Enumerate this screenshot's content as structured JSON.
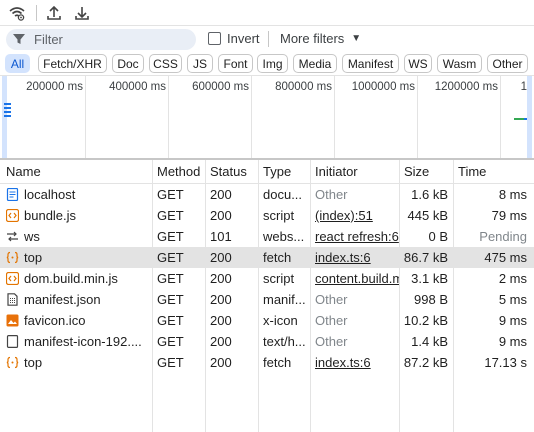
{
  "toolbar": {
    "icons": [
      "network-conditions-icon",
      "import-har-icon",
      "export-har-icon"
    ]
  },
  "filter": {
    "placeholder": "Filter",
    "invert_label": "Invert",
    "invert_checked": false,
    "more_filters_label": "More filters"
  },
  "chips": [
    {
      "label": "All",
      "active": true
    },
    {
      "label": "Fetch/XHR",
      "active": false
    },
    {
      "label": "Doc",
      "active": false
    },
    {
      "label": "CSS",
      "active": false
    },
    {
      "label": "JS",
      "active": false
    },
    {
      "label": "Font",
      "active": false
    },
    {
      "label": "Img",
      "active": false
    },
    {
      "label": "Media",
      "active": false
    },
    {
      "label": "Manifest",
      "active": false
    },
    {
      "label": "WS",
      "active": false
    },
    {
      "label": "Wasm",
      "active": false
    },
    {
      "label": "Other",
      "active": false
    }
  ],
  "overview": {
    "ticks": [
      "200000 ms",
      "400000 ms",
      "600000 ms",
      "800000 ms",
      "1000000 ms",
      "1200000 ms",
      "1"
    ]
  },
  "table": {
    "columns": [
      "Name",
      "Method",
      "Status",
      "Type",
      "Initiator",
      "Size",
      "Time"
    ],
    "rows": [
      {
        "icon": "document-icon",
        "name": "localhost",
        "method": "GET",
        "status": "200",
        "type": "docu...",
        "initiator": "Other",
        "initiator_link": false,
        "size": "1.6 kB",
        "time": "8 ms",
        "time_muted": false,
        "selected": false
      },
      {
        "icon": "script-icon",
        "name": "bundle.js",
        "method": "GET",
        "status": "200",
        "type": "script",
        "initiator": "(index):51",
        "initiator_link": true,
        "size": "445 kB",
        "time": "79 ms",
        "time_muted": false,
        "selected": false
      },
      {
        "icon": "websocket-icon",
        "name": "ws",
        "method": "GET",
        "status": "101",
        "type": "webs...",
        "initiator": "react refresh:6",
        "initiator_link": true,
        "size": "0 B",
        "time": "Pending",
        "time_muted": true,
        "selected": false
      },
      {
        "icon": "fetch-icon",
        "name": "top",
        "method": "GET",
        "status": "200",
        "type": "fetch",
        "initiator": "index.ts:6",
        "initiator_link": true,
        "size": "86.7 kB",
        "time": "475 ms",
        "time_muted": false,
        "selected": true
      },
      {
        "icon": "script-icon",
        "name": "dom.build.min.js",
        "method": "GET",
        "status": "200",
        "type": "script",
        "initiator": "content.build.m",
        "initiator_link": true,
        "size": "3.1 kB",
        "time": "2 ms",
        "time_muted": false,
        "selected": false
      },
      {
        "icon": "manifest-icon",
        "name": "manifest.json",
        "method": "GET",
        "status": "200",
        "type": "manif...",
        "initiator": "Other",
        "initiator_link": false,
        "size": "998 B",
        "time": "5 ms",
        "time_muted": false,
        "selected": false
      },
      {
        "icon": "image-icon",
        "name": "favicon.ico",
        "method": "GET",
        "status": "200",
        "type": "x-icon",
        "initiator": "Other",
        "initiator_link": false,
        "size": "10.2 kB",
        "time": "9 ms",
        "time_muted": false,
        "selected": false
      },
      {
        "icon": "blank-file-icon",
        "name": "manifest-icon-192....",
        "method": "GET",
        "status": "200",
        "type": "text/h...",
        "initiator": "Other",
        "initiator_link": false,
        "size": "1.4 kB",
        "time": "9 ms",
        "time_muted": false,
        "selected": false
      },
      {
        "icon": "fetch-icon",
        "name": "top",
        "method": "GET",
        "status": "200",
        "type": "fetch",
        "initiator": "index.ts:6",
        "initiator_link": true,
        "size": "87.2 kB",
        "time": "17.13 s",
        "time_muted": false,
        "selected": false
      }
    ]
  },
  "colors": {
    "accent": "#0b57d0",
    "chip_active_bg": "#d3e3fd",
    "selected_row": "#e3e3e3",
    "doc_icon": "#1a73e8",
    "script_icon": "#e37400",
    "image_icon": "#e8710a"
  }
}
